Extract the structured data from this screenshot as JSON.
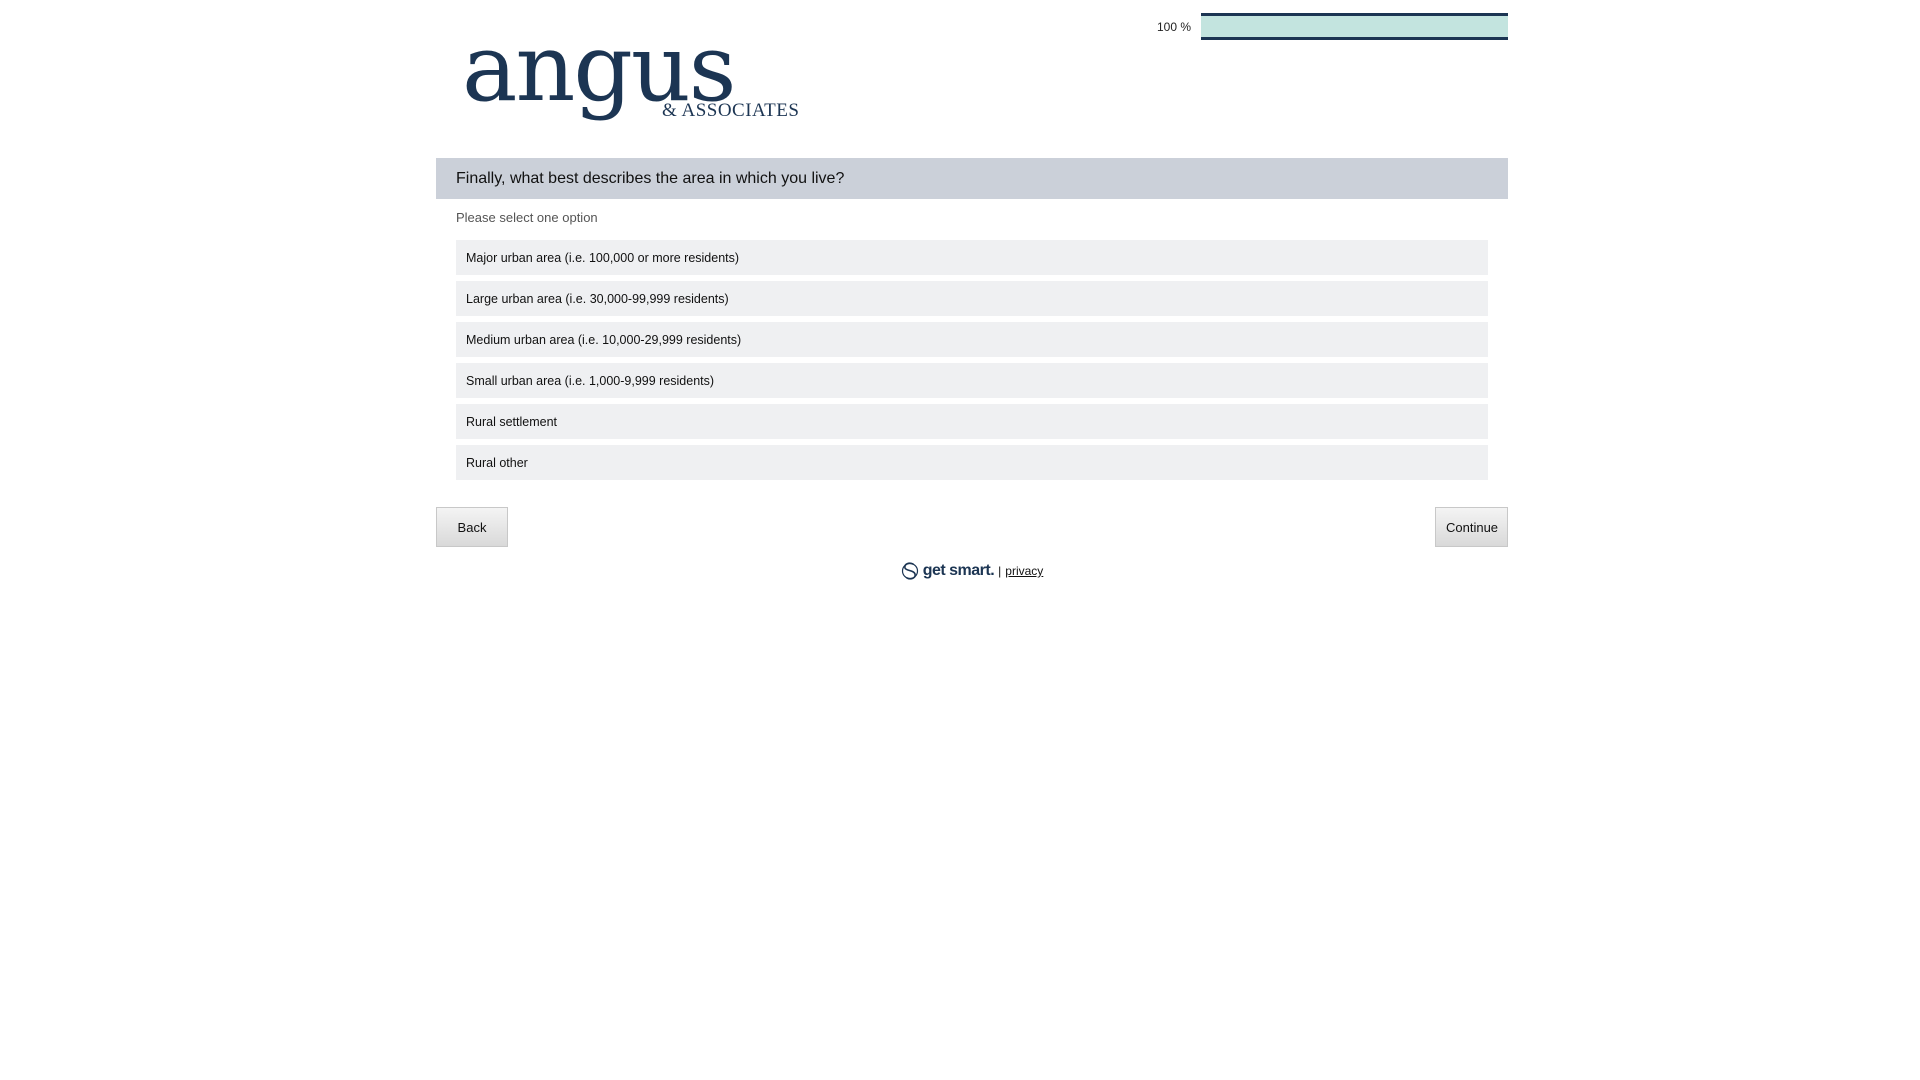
{
  "header": {
    "logo_main": "angus",
    "logo_sub": "& ASSOCIATES",
    "progress_text": "100 %",
    "progress_value": 100,
    "progress_fill_color": "#c3e4df",
    "progress_border_color": "#1c3553"
  },
  "question": {
    "title": "Finally, what best describes the area in which you live?",
    "instruction": "Please select one option",
    "options": [
      {
        "label": "Major urban area (i.e. 100,000 or more residents)"
      },
      {
        "label": "Large urban area (i.e. 30,000-99,999 residents)"
      },
      {
        "label": "Medium urban area (i.e. 10,000-29,999 residents)"
      },
      {
        "label": "Small urban area (i.e. 1,000-9,999 residents)"
      },
      {
        "label": "Rural settlement"
      },
      {
        "label": "Rural other"
      }
    ]
  },
  "nav": {
    "back_label": "Back",
    "continue_label": "Continue"
  },
  "footer": {
    "brand_text": "get smart.",
    "brand_icon": "getsmart-logo-icon",
    "separator": "|",
    "privacy_label": "privacy"
  },
  "colors": {
    "brand": "#1c3553",
    "question_bar": "#cbd0d9",
    "option_bg": "#eff0f2"
  }
}
